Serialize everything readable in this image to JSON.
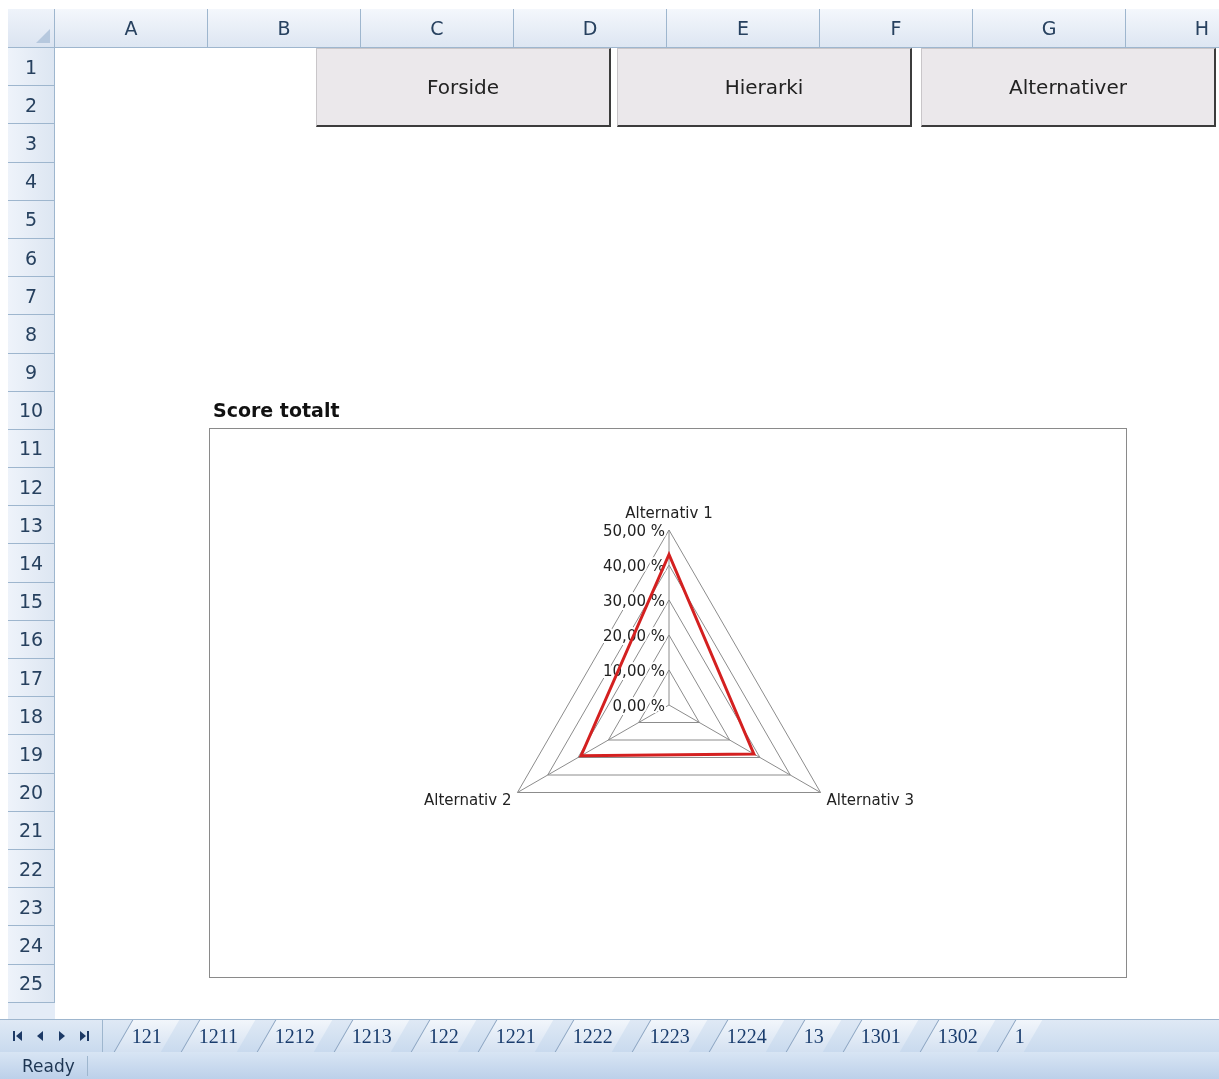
{
  "columns": [
    "A",
    "B",
    "C",
    "D",
    "E",
    "F",
    "G",
    "H"
  ],
  "rows": [
    "1",
    "2",
    "3",
    "4",
    "5",
    "6",
    "7",
    "8",
    "9",
    "10",
    "11",
    "12",
    "13",
    "14",
    "15",
    "16",
    "17",
    "18",
    "19",
    "20",
    "21",
    "22",
    "23",
    "24",
    "25"
  ],
  "buttons": [
    "Forside",
    "Hierarki",
    "Alternativer"
  ],
  "chart": {
    "chart_data": {
      "type": "radar",
      "title": "Score totalt",
      "categories": [
        "Alternativ 1",
        "Alternativ 3",
        "Alternativ 2"
      ],
      "series": [
        {
          "color": "#d42020",
          "values": [
            0.43,
            0.28,
            0.29
          ]
        }
      ],
      "ylim": [
        0,
        0.5
      ],
      "yticks": [
        {
          "value": 0,
          "label": "0,00 %"
        },
        {
          "value": 0.1,
          "label": "10,00 %"
        },
        {
          "value": 0.2,
          "label": "20,00 %"
        },
        {
          "value": 0.3,
          "label": "30,00 %"
        },
        {
          "value": 0.4,
          "label": "40,00 %"
        },
        {
          "value": 0.5,
          "label": "50,00 %"
        }
      ]
    }
  },
  "sheet_tabs": [
    {
      "label": "121"
    },
    {
      "label": "1211"
    },
    {
      "label": "1212"
    },
    {
      "label": "1213"
    },
    {
      "label": "122"
    },
    {
      "label": "1221"
    },
    {
      "label": "1222"
    },
    {
      "label": "1223"
    },
    {
      "label": "1224"
    },
    {
      "label": "13"
    },
    {
      "label": "1301"
    },
    {
      "label": "1302"
    },
    {
      "label": "1"
    }
  ],
  "status_bar": {
    "text": "Ready"
  }
}
